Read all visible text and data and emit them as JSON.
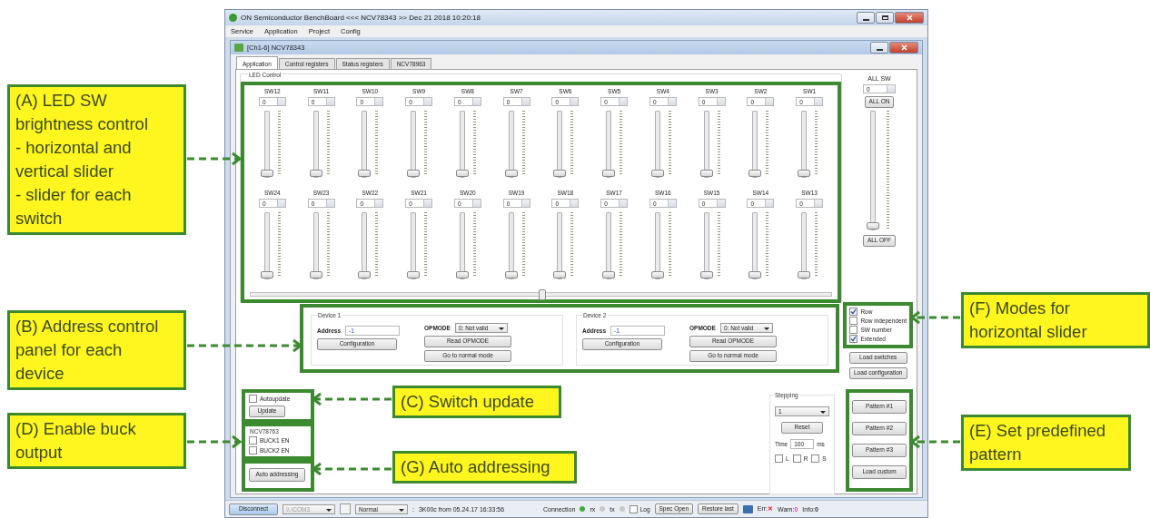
{
  "window": {
    "title": "ON Semiconductor BenchBoard <<< NCV78343 >> Dec 21 2018 10:20:18"
  },
  "menu": [
    "Service",
    "Application",
    "Project",
    "Config"
  ],
  "document": {
    "title": "[Ch1-6] NCV78343"
  },
  "tabs": [
    {
      "label": "Application",
      "selected": true
    },
    {
      "label": "Control registers",
      "selected": false
    },
    {
      "label": "Status registers",
      "selected": false
    },
    {
      "label": "NCV78963",
      "selected": false
    }
  ],
  "led_control": {
    "title": "LED Control",
    "rows": [
      [
        {
          "name": "SW12",
          "value": "0",
          "level": 0
        },
        {
          "name": "SW11",
          "value": "0",
          "level": 0
        },
        {
          "name": "SW10",
          "value": "0",
          "level": 0
        },
        {
          "name": "SW9",
          "value": "0",
          "level": 0
        },
        {
          "name": "SW8",
          "value": "0",
          "level": 0
        },
        {
          "name": "SW7",
          "value": "0",
          "level": 0
        },
        {
          "name": "SW6",
          "value": "0",
          "level": 0
        },
        {
          "name": "SW5",
          "value": "0",
          "level": 0
        },
        {
          "name": "SW4",
          "value": "0",
          "level": 0
        },
        {
          "name": "SW3",
          "value": "0",
          "level": 0
        },
        {
          "name": "SW2",
          "value": "0",
          "level": 0
        },
        {
          "name": "SW1",
          "value": "0",
          "level": 0
        }
      ],
      [
        {
          "name": "SW24",
          "value": "0",
          "level": 0
        },
        {
          "name": "SW23",
          "value": "0",
          "level": 0
        },
        {
          "name": "SW22",
          "value": "0",
          "level": 0
        },
        {
          "name": "SW21",
          "value": "0",
          "level": 0
        },
        {
          "name": "SW20",
          "value": "0",
          "level": 0
        },
        {
          "name": "SW19",
          "value": "0",
          "level": 0
        },
        {
          "name": "SW18",
          "value": "0",
          "level": 0
        },
        {
          "name": "SW17",
          "value": "0",
          "level": 0
        },
        {
          "name": "SW16",
          "value": "0",
          "level": 0
        },
        {
          "name": "SW15",
          "value": "0",
          "level": 0
        },
        {
          "name": "SW14",
          "value": "0",
          "level": 0
        },
        {
          "name": "SW13",
          "value": "0",
          "level": 0
        }
      ]
    ],
    "horizontal_slider": {
      "level": 0.5
    }
  },
  "all_sw": {
    "label": "ALL SW",
    "value": "0",
    "on_button": "ALL ON",
    "off_button": "ALL OFF",
    "level": 0
  },
  "modes": [
    {
      "label": "Row",
      "checked": true
    },
    {
      "label": "Row independent",
      "checked": false
    },
    {
      "label": "SW number",
      "checked": false
    },
    {
      "label": "Extended",
      "checked": true
    }
  ],
  "load_buttons": [
    "Load switches",
    "Load configuration"
  ],
  "devices": [
    {
      "title": "Device 1",
      "address_label": "Address",
      "address": "-1",
      "opmode_label": "OPMODE",
      "opmode": "0: Not valid",
      "buttons": [
        "Configuration",
        "Read OPMODE",
        "Go to normal mode"
      ]
    },
    {
      "title": "Device 2",
      "address_label": "Address",
      "address": "-1",
      "opmode_label": "OPMODE",
      "opmode": "0: Not valid",
      "buttons": [
        "Configuration",
        "Read OPMODE",
        "Go to normal mode"
      ]
    }
  ],
  "autoupdate": {
    "label": "Autoupdate",
    "checked": false
  },
  "update_button": "Update",
  "buck": {
    "title": "NCV78763",
    "items": [
      {
        "label": "BUCK1 EN",
        "checked": false
      },
      {
        "label": "BUCK2 EN",
        "checked": false
      }
    ]
  },
  "auto_addressing": "Auto addressing",
  "stepping": {
    "title": "Stepping",
    "value": "1",
    "reset": "Reset",
    "time_label": "Time",
    "time": "100",
    "unit": "ms",
    "flags": [
      {
        "label": "L",
        "checked": false
      },
      {
        "label": "R",
        "checked": false
      },
      {
        "label": "S",
        "checked": false
      }
    ]
  },
  "patterns": [
    "Pattern #1",
    "Pattern #2",
    "Pattern #3",
    "Load custom"
  ],
  "status_bar": {
    "disconnect": "Disconnect",
    "port": "\\\\.\\COM3",
    "mode": "Normal",
    "separator": ":",
    "info": "3K00c from 05.24.17 16:33:56",
    "connection": "Connection",
    "leds": [
      {
        "on": true,
        "label": "rx"
      },
      {
        "on": false,
        "label": "tx"
      },
      {
        "on": false
      }
    ],
    "log": {
      "label": "Log",
      "checked": false
    },
    "spec": "Spec Open",
    "restore": "Restore last",
    "messages": [
      {
        "label": "Err:",
        "value": "✕",
        "kind": "error"
      },
      {
        "label": "Warn:",
        "value": "0",
        "kind": "warning"
      },
      {
        "label": "Info:",
        "value": "0",
        "kind": "info"
      }
    ]
  },
  "annotations": [
    {
      "lines": [
        "(A) LED SW",
        "brightness control",
        "- horizontal and",
        "vertical slider",
        "- slider for each",
        "switch"
      ]
    },
    {
      "lines": [
        "(B) Address control",
        "panel for each",
        "device"
      ]
    },
    {
      "lines": [
        "(D) Enable buck",
        "output"
      ]
    },
    {
      "lines": [
        "(C) Switch update"
      ]
    },
    {
      "lines": [
        "(G) Auto addressing"
      ]
    },
    {
      "lines": [
        "(F) Modes for",
        "horizontal slider"
      ]
    },
    {
      "lines": [
        "(E) Set predefined",
        "pattern"
      ]
    }
  ]
}
